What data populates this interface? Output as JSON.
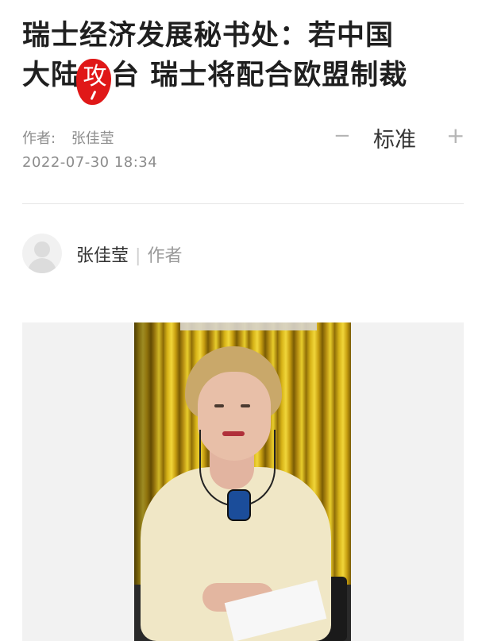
{
  "article": {
    "title_line1": "瑞士经济发展秘书处：若中国",
    "title_line2_before": "大陆",
    "title_line2_stamp": "攻",
    "title_line2_after": "台 瑞士将配合欧盟制裁",
    "author_label": "作者:",
    "author_name": "张佳莹",
    "date": "2022-07-30 18:34"
  },
  "font_control": {
    "minus": "−",
    "label": "标准",
    "plus": "+"
  },
  "author_card": {
    "name": "张佳莹",
    "separator": "|",
    "role": "作者"
  },
  "colors": {
    "stamp": "#e01818",
    "text_primary": "#1f1f1f",
    "text_secondary": "#8c8c8c"
  }
}
